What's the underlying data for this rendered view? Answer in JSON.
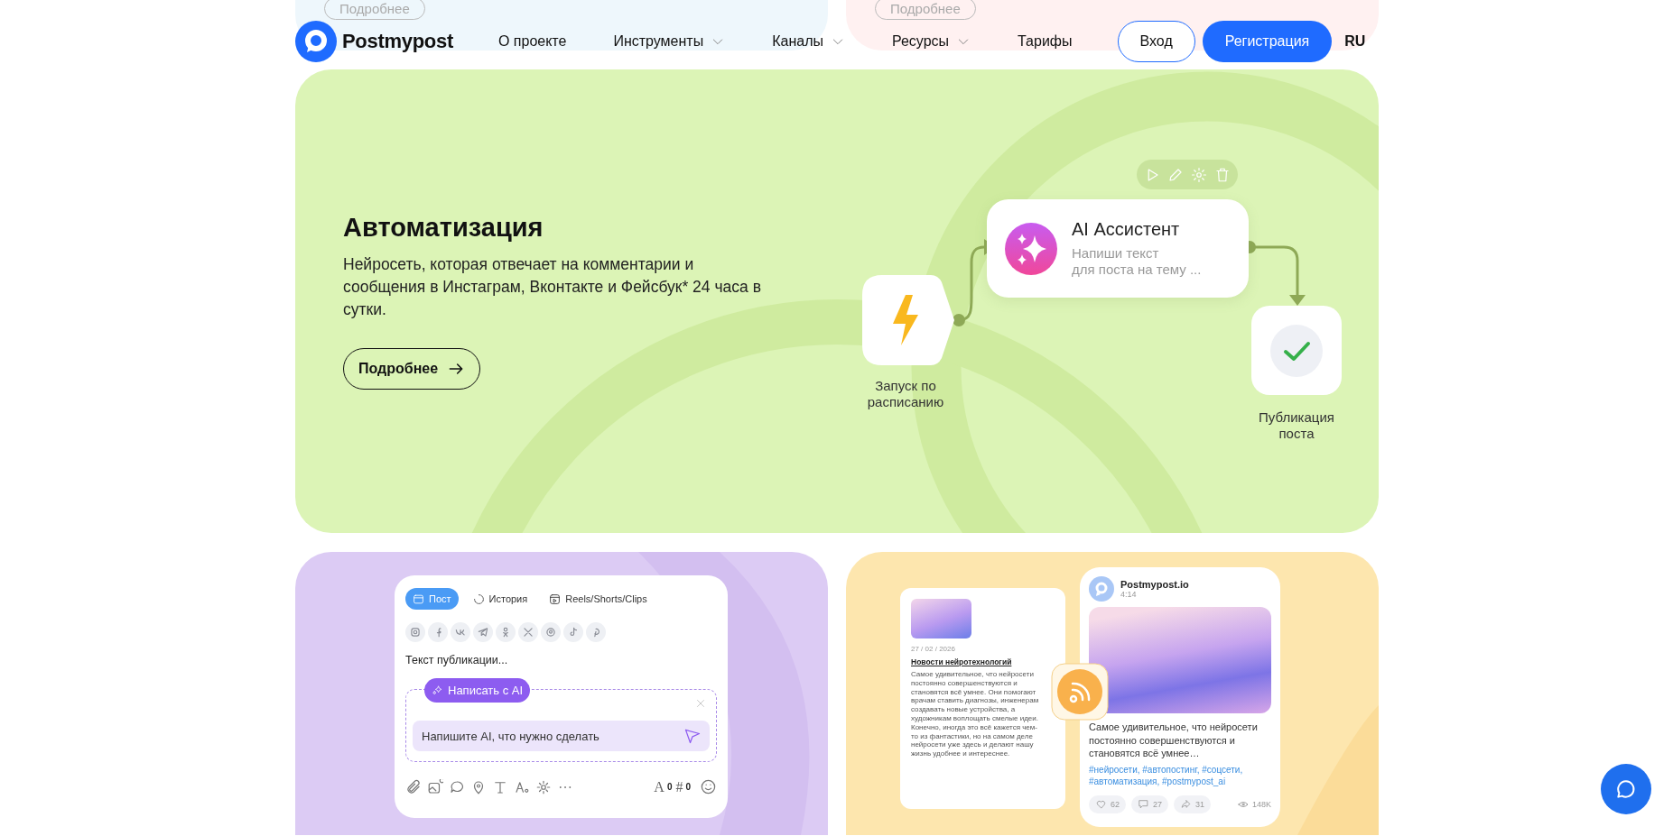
{
  "top_cards": [
    {
      "button": "Подробнее",
      "color": "#eef7fc"
    },
    {
      "button": "Подробнее",
      "color": "#fff1f1"
    }
  ],
  "header": {
    "logo": "Postmypost",
    "nav": [
      {
        "label": "О проекте",
        "dropdown": false
      },
      {
        "label": "Инструменты",
        "dropdown": true
      },
      {
        "label": "Каналы",
        "dropdown": true
      },
      {
        "label": "Ресурсы",
        "dropdown": true
      },
      {
        "label": "Тарифы",
        "dropdown": false
      }
    ],
    "login": "Вход",
    "register": "Регистрация",
    "language": {
      "label": "RU",
      "selected": true
    }
  },
  "automation": {
    "title": "Автоматизация",
    "description": "Нейросеть, которая отвечает на комментарии и сообщения в Инстаграм, Вконтакте и Фейсбук* 24 часа в сутки.",
    "button": "Подробнее",
    "flow": {
      "trigger_label": "Запуск по расписанию",
      "assistant_title": "AI Ассистент",
      "assistant_lines": [
        "Напиши текст",
        "для поста на тему ..."
      ],
      "publish_label": "Публикация поста"
    }
  },
  "editor": {
    "tabs": [
      {
        "label": "Пост",
        "selected": true
      },
      {
        "label": "История",
        "selected": false
      },
      {
        "label": "Reels/Shorts/Clips",
        "selected": false
      }
    ],
    "text_placeholder": "Текст публикации...",
    "ai_button": "Написать с AI",
    "ai_input": {
      "placeholder": "Напишите AI, что нужно сделать"
    },
    "counters": [
      {
        "symbol": "A",
        "value": "0"
      },
      {
        "symbol": "#",
        "value": "0"
      }
    ]
  },
  "article": {
    "date": "27 / 02 / 2026",
    "title": "Новости нейротехнологий",
    "body": "Самое удивительное, что нейросети постоянно совершенствуются и становятся всё умнее. Они помогают врачам ставить диагнозы, инженерам создавать новые устройства, а художникам воплощать смелые идеи. Конечно, иногда это всё кажется чем-то из фантастики, но на самом деле нейросети уже здесь и делают нашу жизнь удобнее и интереснее."
  },
  "post": {
    "author": "Postmypost.io",
    "time": "4:14",
    "text": "Самое удивительное, что нейросети постоянно совершенствуются и становятся всё умнее…",
    "hashtags": "#нейросети, #автопостинг, #соцсети, #автоматизация, #postmypost_ai",
    "reactions": [
      {
        "kind": "like",
        "count": "62"
      },
      {
        "kind": "comment",
        "count": "27"
      },
      {
        "kind": "share",
        "count": "31"
      }
    ],
    "views": "148K"
  }
}
